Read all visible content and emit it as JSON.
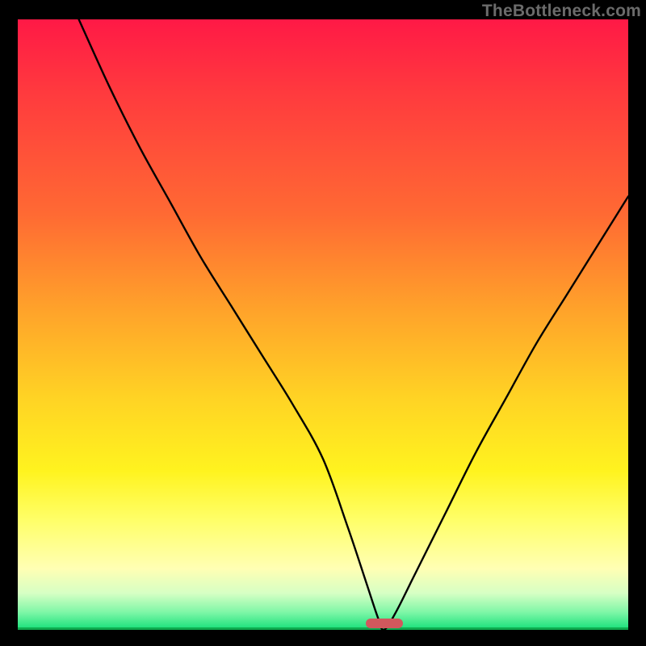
{
  "watermark": "TheBottleneck.com",
  "colors": {
    "frame": "#000000",
    "curve": "#000000",
    "marker": "#d1585d"
  },
  "chart_data": {
    "type": "line",
    "title": "",
    "xlabel": "",
    "ylabel": "",
    "xlim": [
      0,
      100
    ],
    "ylim": [
      0,
      100
    ],
    "grid": false,
    "legend": false,
    "series": [
      {
        "name": "bottleneck-curve",
        "x": [
          10,
          15,
          20,
          25,
          30,
          35,
          40,
          45,
          50,
          54,
          57,
          59,
          60,
          62,
          65,
          70,
          75,
          80,
          85,
          90,
          95,
          100
        ],
        "y": [
          100,
          89,
          79,
          70,
          61,
          53,
          45,
          37,
          28,
          17,
          8,
          2,
          0,
          3,
          9,
          19,
          29,
          38,
          47,
          55,
          63,
          71
        ]
      }
    ],
    "marker": {
      "x": 60,
      "y": 0,
      "shape": "pill"
    },
    "background_gradient": {
      "direction": "vertical",
      "stops": [
        {
          "pos": 0.0,
          "color": "#ff1946"
        },
        {
          "pos": 0.32,
          "color": "#ff6a33"
        },
        {
          "pos": 0.62,
          "color": "#ffd324"
        },
        {
          "pos": 0.9,
          "color": "#ffffb4"
        },
        {
          "pos": 1.0,
          "color": "#15e07a"
        }
      ]
    }
  }
}
